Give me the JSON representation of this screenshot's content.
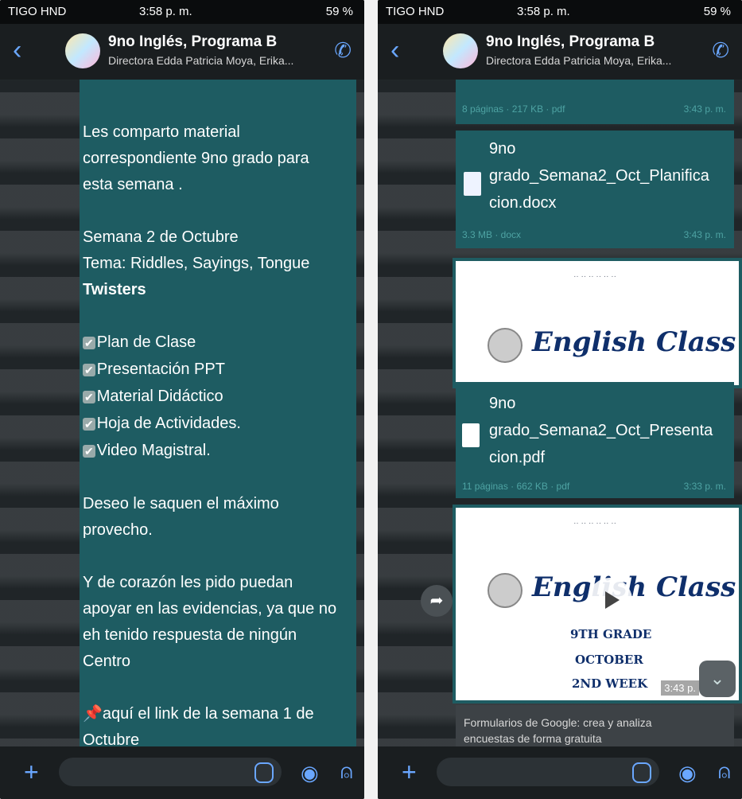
{
  "status": {
    "carrier": "TIGO HND",
    "time": "3:58 p. m.",
    "battery": "59 %"
  },
  "chat": {
    "title": "9no Inglés, Programa B",
    "subtitle": "Directora Edda Patricia Moya, Erika..."
  },
  "left_message": {
    "lines": [
      "Les comparto material",
      "correspondiente  9no grado para",
      "esta semana .",
      "",
      "Semana 2 de Octubre",
      "Tema: Riddles, Sayings, Tongue",
      "Twisters",
      "",
      "Plan de Clase",
      "Presentación PPT",
      "Material Didáctico",
      "Hoja de Actividades.",
      "Video Magistral.",
      "",
      "Deseo le saquen el máximo",
      "provecho.",
      "",
      "Y de corazón les pido puedan",
      "apoyar en las evidencias, ya que no",
      "eh tenido respuesta de ningún",
      "Centro",
      "",
      "aquí el link de la semana 1 de",
      "Octubre"
    ]
  },
  "right_messages": {
    "doc1_meta": "8 páginas · 217 KB · pdf",
    "doc1_time": "3:43 p. m.",
    "doc2_name_l1": "9no",
    "doc2_name_l2": "grado_Semana2_Oct_Planifica",
    "doc2_name_l3": "cion.docx",
    "doc2_meta": "3.3 MB · docx",
    "doc2_time": "3:43 p. m.",
    "image_title": "English Class",
    "doc3_name_l1": "9no",
    "doc3_name_l2": "grado_Semana2_Oct_Presenta",
    "doc3_name_l3": "cion.pdf",
    "doc3_meta": "11 páginas · 662 KB · pdf",
    "doc3_time": "3:33 p. m.",
    "video_title": "English Class",
    "video_line1": "9TH GRADE",
    "video_line2": "OCTOBER",
    "video_line3": "2ND WEEK",
    "video_time": "3:43 p.",
    "forms_line1": "Formularios de Google: crea y analiza",
    "forms_line2": "encuestas de forma gratuita"
  }
}
